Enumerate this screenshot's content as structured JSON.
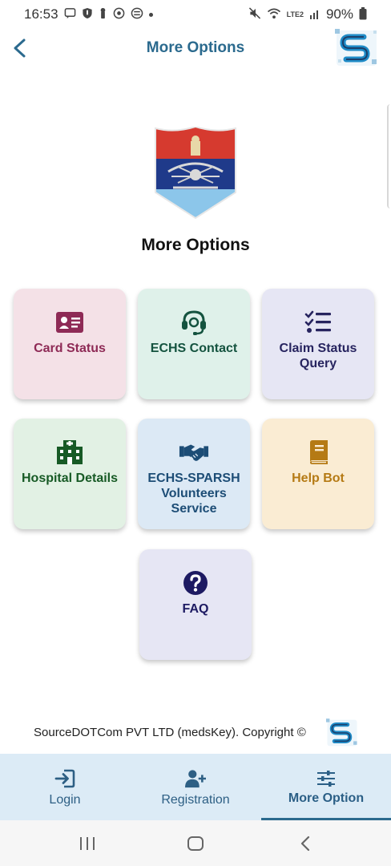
{
  "status_bar": {
    "time": "16:53",
    "battery": "90%",
    "network_label": "LTE2",
    "icons_left": [
      "message-icon",
      "shield-icon",
      "lock-icon",
      "sync-icon",
      "data-icon"
    ],
    "icons_right": [
      "mute-icon",
      "wifi-icon",
      "signal-icon",
      "battery-icon"
    ]
  },
  "header": {
    "title": "More Options",
    "back_icon": "chevron-left-icon"
  },
  "main": {
    "heading": "More Options",
    "cards": [
      {
        "label": "Card Status",
        "icon": "id-card-icon"
      },
      {
        "label": "ECHS Contact",
        "icon": "headset-icon"
      },
      {
        "label": "Claim Status Query",
        "icon": "checklist-icon"
      },
      {
        "label": "Hospital Details",
        "icon": "hospital-icon"
      },
      {
        "label": "ECHS-SPARSH Volunteers Service",
        "icon": "handshake-icon"
      },
      {
        "label": "Help Bot",
        "icon": "book-icon"
      },
      {
        "label": "FAQ",
        "icon": "question-icon"
      }
    ]
  },
  "footer": {
    "copyright": "SourceDOTCom PVT LTD (medsKey). Copyright ©"
  },
  "bottom_nav": {
    "items": [
      {
        "label": "Login",
        "icon": "login-icon"
      },
      {
        "label": "Registration",
        "icon": "add-user-icon"
      },
      {
        "label": "More Option",
        "icon": "sliders-icon",
        "active": true
      }
    ]
  },
  "colors": {
    "accent": "#2b6a8e",
    "nav_background": "#dcebf6"
  }
}
